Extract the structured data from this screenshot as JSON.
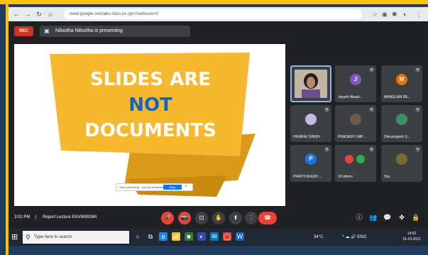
{
  "browser": {
    "nav_icons": [
      "←",
      "→",
      "↻",
      "⌂"
    ],
    "url": "meet.google.com/abc-docs-jxr-jqrv?authuser=0",
    "right_icons": [
      "☆",
      "◉",
      "✱",
      "◐",
      "⋮"
    ]
  },
  "meet": {
    "rec_label": "REC",
    "presenting_text": "Nilootha Nilootha is presenting",
    "slide": {
      "line1": "SLIDES ARE",
      "line2": "NOT",
      "line3": "DOCUMENTS",
      "colors": {
        "banner": "#f5b82e",
        "banner_dark": "#d99a1a",
        "text_white": "#ffffff",
        "text_blue": "#1565c0"
      }
    },
    "stop_bar": {
      "text": "Stop presenting · you are presenting",
      "button": "Stop",
      "close": "×"
    },
    "participants": [
      {
        "name": "",
        "initial": "",
        "color": "",
        "photo": true
      },
      {
        "name": "Jayash Akash...",
        "initial": "J",
        "color": "#7e57c2"
      },
      {
        "name": "MANGLAM RE...",
        "initial": "M",
        "color": "#e8710a"
      },
      {
        "name": "HEMRAJ SINGH",
        "initial": "",
        "color": "#c5b8e8"
      },
      {
        "name": "PRADEEP LMP...",
        "initial": "",
        "color": "#6d5b4a"
      },
      {
        "name": "Dhruvrajsinh S...",
        "initial": "",
        "color": "#3e8e6a"
      },
      {
        "name": "PRATIYUKASH ...",
        "initial": "P",
        "color": "#1a73e8"
      },
      {
        "name": "10 others",
        "initial": "",
        "color": "#ea4335"
      },
      {
        "name": "You",
        "initial": "",
        "color": "#7a6a3a"
      }
    ],
    "controls": {
      "time": "3:02 PM",
      "separator": "|",
      "meeting_name": "Report Lecture ENVM0926N",
      "buttons": [
        "🎤",
        "📷",
        "⊡",
        "✋",
        "⬆",
        "⋮"
      ],
      "end_icon": "☎",
      "right_icons": [
        "ⓘ",
        "👥",
        "💬",
        "✤",
        "🔒"
      ]
    }
  },
  "taskbar": {
    "start_icon": "⊞",
    "search_icon": "⚲",
    "search_placeholder": "Type here to search",
    "apps": [
      "○",
      "⧉",
      "e",
      "📁",
      "■",
      "◐",
      "✉",
      "◯",
      "W"
    ],
    "tray_text": "^ ☁ 🔊 ENG",
    "weather": "34°C",
    "clock_time": "14:52",
    "clock_date": "16-10-2021"
  }
}
